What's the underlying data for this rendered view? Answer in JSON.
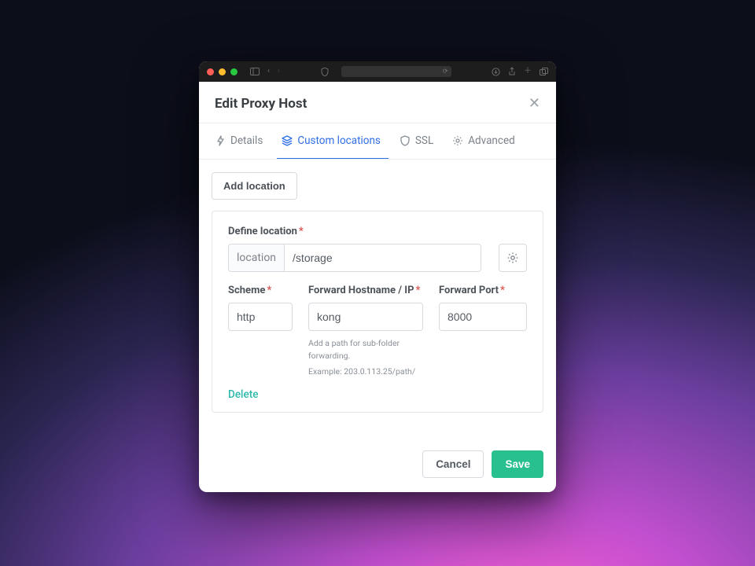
{
  "modal": {
    "title": "Edit Proxy Host"
  },
  "tabs": {
    "details": "Details",
    "custom_locations": "Custom locations",
    "ssl": "SSL",
    "advanced": "Advanced"
  },
  "buttons": {
    "add_location": "Add location",
    "cancel": "Cancel",
    "save": "Save",
    "delete": "Delete"
  },
  "form": {
    "define_location_label": "Define location",
    "location_prefix": "location",
    "location_value": "/storage",
    "scheme_label": "Scheme",
    "scheme_value": "http",
    "hostname_label": "Forward Hostname / IP",
    "hostname_value": "kong",
    "port_label": "Forward Port",
    "port_value": "8000",
    "hint_line1": "Add a path for sub-folder forwarding.",
    "hint_line2": "Example: 203.0.113.25/path/"
  }
}
